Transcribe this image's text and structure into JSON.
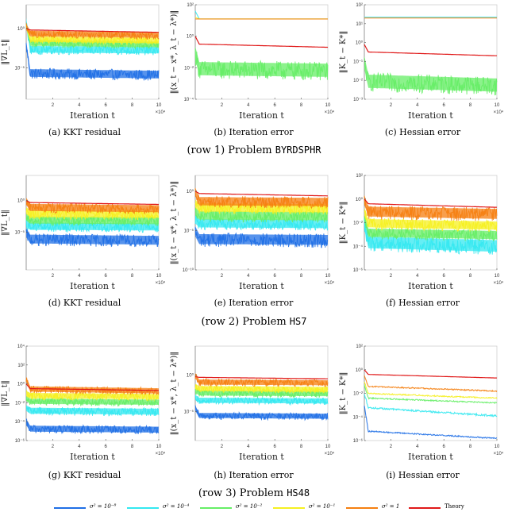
{
  "series_styles": [
    {
      "name": "σ² = 10⁻⁸",
      "color": "#1f6fe6"
    },
    {
      "name": "σ² = 10⁻⁴",
      "color": "#33e8f0"
    },
    {
      "name": "σ² = 10⁻²",
      "color": "#66ee66"
    },
    {
      "name": "σ² = 10⁻¹",
      "color": "#f5f020"
    },
    {
      "name": "σ² = 1",
      "color": "#f57f10"
    },
    {
      "name": "Theory",
      "color": "#e01818"
    }
  ],
  "rows": [
    {
      "caption_prefix": "(row 1) Problem ",
      "caption_problem": "BYRDSPHR"
    },
    {
      "caption_prefix": "(row 2) Problem ",
      "caption_problem": "HS7"
    },
    {
      "caption_prefix": "(row 3) Problem ",
      "caption_problem": "HS48"
    }
  ],
  "legend": [
    {
      "label": "σ² = 10⁻⁸"
    },
    {
      "label": "σ² = 10⁻⁴"
    },
    {
      "label": "σ² = 10⁻²"
    },
    {
      "label": "σ² = 10⁻¹"
    },
    {
      "label": "σ² = 1"
    },
    {
      "label": "Theory"
    }
  ],
  "chart_data": [
    {
      "id": "a",
      "type": "line",
      "caption": "(a) KKT residual",
      "ylabel": "‖∇L_t‖",
      "xlabel": "Iteration t",
      "xlim": [
        0,
        10
      ],
      "x_multiplier": "×10⁴",
      "xticks": [
        2,
        4,
        6,
        8,
        10
      ],
      "ylim_log10": [
        -9,
        3
      ],
      "yticks_log10": [
        0,
        -5
      ],
      "ytick_labels": [
        "10⁰",
        "10⁻⁵"
      ],
      "series": [
        {
          "name": "σ² = 10⁻⁸",
          "start_log10": -2,
          "level_log10": -5.6,
          "noise": 1.4,
          "ends_log10": -5.8
        },
        {
          "name": "σ² = 10⁻⁴",
          "start_log10": 1,
          "level_log10": -2.6,
          "noise": 1.2,
          "ends_log10": -2.7
        },
        {
          "name": "σ² = 10⁻²",
          "start_log10": 0.5,
          "level_log10": -1.8,
          "noise": 1.0,
          "ends_log10": -2.0
        },
        {
          "name": "σ² = 10⁻¹",
          "start_log10": 0.3,
          "level_log10": -1.3,
          "noise": 1.0,
          "ends_log10": -1.5
        },
        {
          "name": "σ² = 1",
          "start_log10": 0.3,
          "level_log10": -0.6,
          "noise": 1.0,
          "ends_log10": -0.8
        },
        {
          "name": "Theory",
          "start_log10": 0,
          "level_log10": -0.2,
          "noise": 0,
          "ends_log10": -0.5
        }
      ]
    },
    {
      "id": "b",
      "type": "line",
      "caption": "(b) Iteration error",
      "ylabel": "‖(x_t − x*, λ_t − λ*)‖",
      "xlabel": "Iteration t",
      "xlim": [
        0,
        10
      ],
      "x_multiplier": "×10⁴",
      "xticks": [
        2,
        4,
        6,
        8,
        10
      ],
      "ylim_log10": [
        -4,
        2
      ],
      "yticks_log10": [
        2,
        0,
        -2,
        -4
      ],
      "ytick_labels": [
        "10²",
        "10⁰",
        "10⁻²",
        "10⁻⁴"
      ],
      "series": [
        {
          "name": "σ² = 10⁻²",
          "start_log10": -1,
          "level_log10": -2,
          "noise": 1.2,
          "ends_log10": -2.1
        },
        {
          "name": "σ² = 10⁻⁴",
          "start_log10": 1.6,
          "level_log10": 1.1,
          "noise": 0,
          "ends_log10": 1.1
        },
        {
          "name": "σ² = 10⁻¹",
          "start_log10": 1.2,
          "level_log10": 1.1,
          "noise": 0,
          "ends_log10": 1.1
        },
        {
          "name": "σ² = 1",
          "start_log10": 1.1,
          "level_log10": 1.1,
          "noise": 0,
          "ends_log10": 1.1
        },
        {
          "name": "Theory",
          "start_log10": 0,
          "level_log10": -0.5,
          "noise": 0,
          "ends_log10": -0.7
        }
      ]
    },
    {
      "id": "c",
      "type": "line",
      "caption": "(c) Hessian error",
      "ylabel": "‖K_t − K*‖",
      "xlabel": "Iteration t",
      "xlim": [
        0,
        10
      ],
      "x_multiplier": "×10⁴",
      "xticks": [
        2,
        4,
        6,
        8,
        10
      ],
      "ylim_log10": [
        -3,
        2
      ],
      "yticks_log10": [
        2,
        1,
        0,
        -1,
        -2,
        -3
      ],
      "ytick_labels": [
        "10²",
        "10¹",
        "10⁰",
        "10⁻¹",
        "10⁻²",
        "10⁻³"
      ],
      "series": [
        {
          "name": "σ² = 10⁻²",
          "start_log10": -1,
          "level_log10": -2,
          "noise": 1.0,
          "ends_log10": -2.2
        },
        {
          "name": "σ² = 10⁻⁴",
          "start_log10": 1.35,
          "level_log10": 1.35,
          "noise": 0,
          "ends_log10": 1.35
        },
        {
          "name": "σ² = 1",
          "start_log10": 1.3,
          "level_log10": 1.3,
          "noise": 0,
          "ends_log10": 1.3
        },
        {
          "name": "Theory",
          "start_log10": -0.1,
          "level_log10": -0.5,
          "noise": 0,
          "ends_log10": -0.7
        }
      ]
    },
    {
      "id": "d",
      "type": "line",
      "caption": "(d) KKT residual",
      "ylabel": "‖∇L_t‖",
      "xlabel": "Iteration t",
      "xlim": [
        0,
        10
      ],
      "x_multiplier": "×10⁴",
      "xticks": [
        2,
        4,
        6,
        8,
        10
      ],
      "ylim_log10": [
        -11,
        4
      ],
      "yticks_log10": [
        0,
        -5
      ],
      "ytick_labels": [
        "10⁰",
        "10⁻⁵"
      ],
      "series": [
        {
          "name": "σ² = 10⁻⁸",
          "start_log10": -5,
          "level_log10": -6,
          "noise": 2.0,
          "ends_log10": -6.2
        },
        {
          "name": "σ² = 10⁻⁴",
          "start_log10": -3.5,
          "level_log10": -4,
          "noise": 1.6,
          "ends_log10": -4.1
        },
        {
          "name": "σ² = 10⁻²",
          "start_log10": -2.5,
          "level_log10": -3,
          "noise": 1.6,
          "ends_log10": -3.1
        },
        {
          "name": "σ² = 10⁻¹",
          "start_log10": -1.5,
          "level_log10": -2,
          "noise": 1.6,
          "ends_log10": -2.1
        },
        {
          "name": "σ² = 1",
          "start_log10": 0,
          "level_log10": -1,
          "noise": 1.6,
          "ends_log10": -1.2
        },
        {
          "name": "Theory",
          "start_log10": 0,
          "level_log10": -0.3,
          "noise": 0,
          "ends_log10": -0.6
        }
      ]
    },
    {
      "id": "e",
      "type": "line",
      "caption": "(e) Iteration error",
      "ylabel": "‖(x_t − x*, λ_t − λ*)‖",
      "xlabel": "Iteration t",
      "xlim": [
        0,
        10
      ],
      "x_multiplier": "×10⁴",
      "xticks": [
        2,
        4,
        6,
        8,
        10
      ],
      "ylim_log10": [
        -10,
        2
      ],
      "yticks_log10": [
        0,
        -5,
        -10
      ],
      "ytick_labels": [
        "10⁰",
        "10⁻⁵",
        "10⁻¹⁰"
      ],
      "series": [
        {
          "name": "σ² = 10⁻⁸",
          "start_log10": -5,
          "level_log10": -6,
          "noise": 1.8,
          "ends_log10": -6.1
        },
        {
          "name": "σ² = 10⁻⁴",
          "start_log10": -3.5,
          "level_log10": -4,
          "noise": 1.5,
          "ends_log10": -4.1
        },
        {
          "name": "σ² = 10⁻²",
          "start_log10": -2.5,
          "level_log10": -3,
          "noise": 1.5,
          "ends_log10": -3.1
        },
        {
          "name": "σ² = 10⁻¹",
          "start_log10": -1.5,
          "level_log10": -2,
          "noise": 1.5,
          "ends_log10": -2.1
        },
        {
          "name": "σ² = 1",
          "start_log10": 0,
          "level_log10": -1.2,
          "noise": 1.5,
          "ends_log10": -1.3
        },
        {
          "name": "Theory",
          "start_log10": 0,
          "level_log10": -0.3,
          "noise": 0,
          "ends_log10": -0.6
        }
      ]
    },
    {
      "id": "f",
      "type": "line",
      "caption": "(f) Hessian error",
      "ylabel": "‖K_t − K*‖",
      "xlabel": "Iteration t",
      "xlim": [
        0,
        10
      ],
      "x_multiplier": "×10⁴",
      "xticks": [
        2,
        4,
        6,
        8,
        10
      ],
      "ylim_log10": [
        -6,
        2
      ],
      "yticks_log10": [
        2,
        0,
        -2,
        -4,
        -6
      ],
      "ytick_labels": [
        "10²",
        "10⁰",
        "10⁻²",
        "10⁻⁴",
        "10⁻⁶"
      ],
      "series": [
        {
          "name": "σ² = 10⁻⁴",
          "start_log10": -2,
          "level_log10": -3.6,
          "noise": 1.4,
          "ends_log10": -3.9
        },
        {
          "name": "σ² = 10⁻²",
          "start_log10": -1.5,
          "level_log10": -2.8,
          "noise": 1.0,
          "ends_log10": -3.0
        },
        {
          "name": "σ² = 10⁻¹",
          "start_log10": -1,
          "level_log10": -2,
          "noise": 1.0,
          "ends_log10": -2.2
        },
        {
          "name": "σ² = 1",
          "start_log10": 0,
          "level_log10": -1,
          "noise": 1.2,
          "ends_log10": -1.2
        },
        {
          "name": "Theory",
          "start_log10": 0,
          "level_log10": -0.4,
          "noise": 0,
          "ends_log10": -0.7
        }
      ]
    },
    {
      "id": "g",
      "type": "line",
      "caption": "(g) KKT residual",
      "ylabel": "‖∇L_t‖",
      "xlabel": "Iteration t",
      "xlim": [
        0,
        10
      ],
      "x_multiplier": "×10⁴",
      "xticks": [
        2,
        4,
        6,
        8,
        10
      ],
      "ylim_log10": [
        -6,
        4
      ],
      "yticks_log10": [
        4,
        2,
        0,
        -2,
        -4,
        -6
      ],
      "ytick_labels": [
        "10⁴",
        "10²",
        "10⁰",
        "10⁻²",
        "10⁻⁴",
        "10⁻⁶"
      ],
      "series": [
        {
          "name": "σ² = 10⁻⁸",
          "start_log10": -4,
          "level_log10": -4.7,
          "noise": 0.9,
          "ends_log10": -4.8
        },
        {
          "name": "σ² = 10⁻⁴",
          "start_log10": -2.5,
          "level_log10": -2.8,
          "noise": 0.9,
          "ends_log10": -2.9
        },
        {
          "name": "σ² = 10⁻²",
          "start_log10": -1.5,
          "level_log10": -1.8,
          "noise": 0.8,
          "ends_log10": -1.9
        },
        {
          "name": "σ² = 10⁻¹",
          "start_log10": -1,
          "level_log10": -1.2,
          "noise": 0.8,
          "ends_log10": -1.3
        },
        {
          "name": "σ² = 1",
          "start_log10": 0.5,
          "level_log10": -0.5,
          "noise": 0.8,
          "ends_log10": -0.7
        },
        {
          "name": "Theory",
          "start_log10": 0,
          "level_log10": -0.5,
          "noise": 0,
          "ends_log10": -0.7
        }
      ]
    },
    {
      "id": "h",
      "type": "line",
      "caption": "(h) Iteration error",
      "ylabel": "‖(x_t − x*, λ_t − λ*)‖",
      "xlabel": "Iteration t",
      "xlim": [
        0,
        10
      ],
      "x_multiplier": "×10⁴",
      "xticks": [
        2,
        4,
        6,
        8,
        10
      ],
      "ylim_log10": [
        -9,
        4
      ],
      "yticks_log10": [
        0,
        -5
      ],
      "ytick_labels": [
        "10⁰",
        "10⁻⁵"
      ],
      "series": [
        {
          "name": "σ² = 10⁻⁸",
          "start_log10": -4.5,
          "level_log10": -5.5,
          "noise": 1.0,
          "ends_log10": -5.6
        },
        {
          "name": "σ² = 10⁻⁴",
          "start_log10": -3,
          "level_log10": -3.4,
          "noise": 1.0,
          "ends_log10": -3.5
        },
        {
          "name": "σ² = 10⁻²",
          "start_log10": -2,
          "level_log10": -2.4,
          "noise": 1.0,
          "ends_log10": -2.5
        },
        {
          "name": "σ² = 10⁻¹",
          "start_log10": -1.5,
          "level_log10": -1.8,
          "noise": 1.0,
          "ends_log10": -1.9
        },
        {
          "name": "σ² = 1",
          "start_log10": 0,
          "level_log10": -0.9,
          "noise": 1.0,
          "ends_log10": -1.0
        },
        {
          "name": "Theory",
          "start_log10": -0.2,
          "level_log10": -0.3,
          "noise": 0,
          "ends_log10": -0.5
        }
      ]
    },
    {
      "id": "i",
      "type": "line",
      "caption": "(i) Hessian error",
      "ylabel": "‖K_t − K*‖",
      "xlabel": "Iteration t",
      "xlim": [
        0,
        10
      ],
      "x_multiplier": "×10⁴",
      "xticks": [
        2,
        4,
        6,
        8,
        10
      ],
      "ylim_log10": [
        -6,
        2
      ],
      "yticks_log10": [
        2,
        0,
        -2,
        -4,
        -6
      ],
      "ytick_labels": [
        "10²",
        "10⁰",
        "10⁻²",
        "10⁻⁴",
        "10⁻⁶"
      ],
      "series": [
        {
          "name": "σ² = 10⁻⁸",
          "start_log10": -3,
          "level_log10": -5.2,
          "noise": 0.1,
          "ends_log10": -5.8
        },
        {
          "name": "σ² = 10⁻⁴",
          "start_log10": -2,
          "level_log10": -3.2,
          "noise": 0.15,
          "ends_log10": -3.9
        },
        {
          "name": "σ² = 10⁻²",
          "start_log10": -1.3,
          "level_log10": -2.4,
          "noise": 0.1,
          "ends_log10": -2.8
        },
        {
          "name": "σ² = 10⁻¹",
          "start_log10": -1.0,
          "level_log10": -2.0,
          "noise": 0.1,
          "ends_log10": -2.4
        },
        {
          "name": "σ² = 1",
          "start_log10": -0.5,
          "level_log10": -1.4,
          "noise": 0.1,
          "ends_log10": -1.8
        },
        {
          "name": "Theory",
          "start_log10": 0,
          "level_log10": -0.4,
          "noise": 0,
          "ends_log10": -0.7
        }
      ]
    }
  ]
}
